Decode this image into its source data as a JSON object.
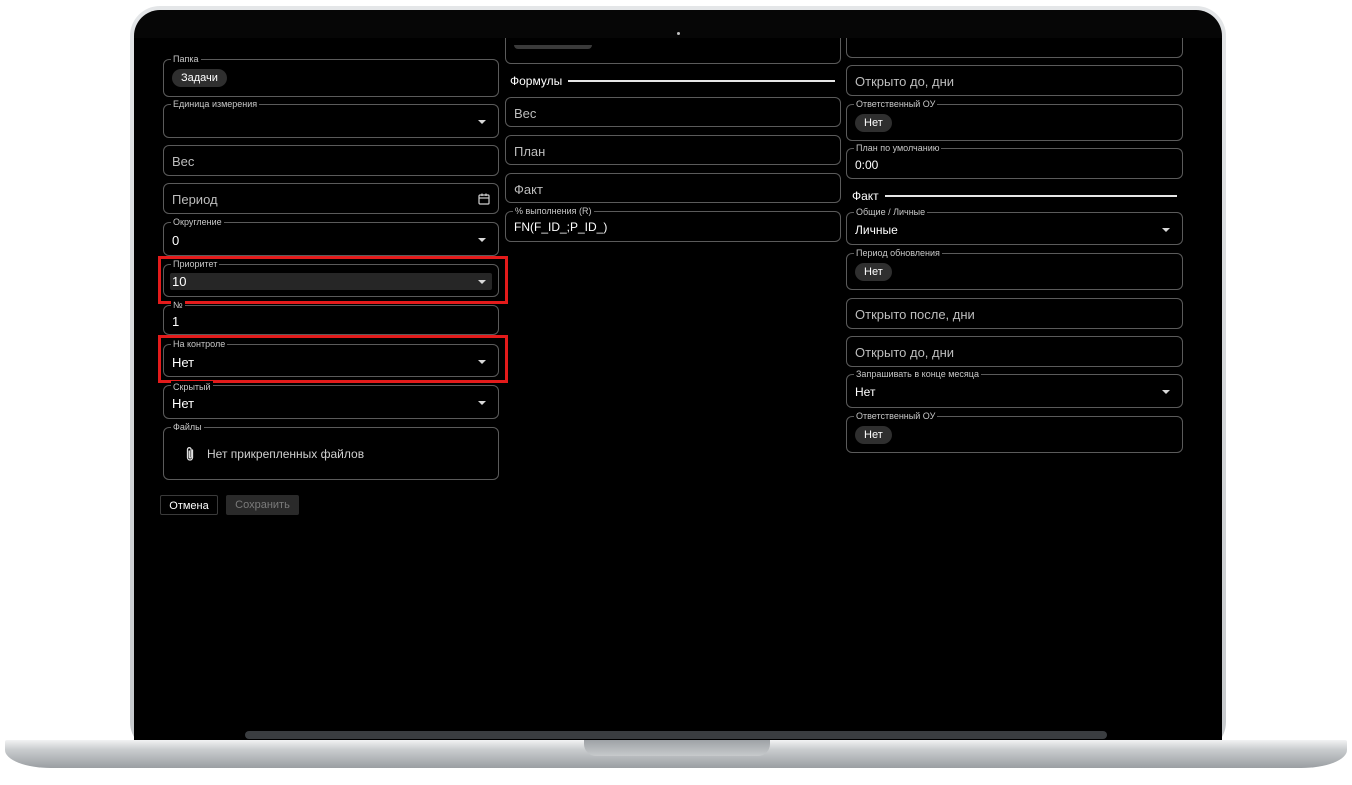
{
  "left": {
    "folder_label": "Папка",
    "folder_chip": "Задачи",
    "unit_label": "Единица измерения",
    "weight_placeholder": "Вес",
    "period_placeholder": "Период",
    "rounding_label": "Округление",
    "rounding_value": "0",
    "priority_label": "Приоритет",
    "priority_value": "10",
    "number_label": "№",
    "number_value": "1",
    "control_label": "На контроле",
    "control_value": "Нет",
    "hidden_label": "Скрытый",
    "hidden_value": "Нет",
    "files_label": "Файлы",
    "files_text": "Нет прикрепленных файлов",
    "cancel_label": "Отмена",
    "save_label": "Сохранить"
  },
  "middle": {
    "formulas_title": "Формулы",
    "weight_placeholder": "Вес",
    "plan_placeholder": "План",
    "fact_placeholder": "Факт",
    "percent_label": "% выполнения (R)",
    "percent_value": "FN(F_ID_;P_ID_)"
  },
  "right": {
    "open_until_placeholder": "Открыто до, дни",
    "responsible_label": "Ответственный ОУ",
    "responsible_chip": "Нет",
    "default_plan_label": "План по умолчанию",
    "default_plan_value": "0:00",
    "fact_title": "Факт",
    "common_label": "Общие / Личные",
    "common_value": "Личные",
    "update_period_label": "Период обновления",
    "update_period_chip": "Нет",
    "open_after_placeholder": "Открыто после, дни",
    "open_until2_placeholder": "Открыто до, дни",
    "ask_label": "Запрашивать в конце месяца",
    "ask_value": "Нет",
    "responsible2_label": "Ответственный ОУ",
    "responsible2_chip": "Нет"
  },
  "colors": {
    "highlight": "#e31b1b",
    "background": "#000000"
  },
  "icons": [
    "calendar-icon",
    "paperclip-icon",
    "chevron-down-icon"
  ]
}
